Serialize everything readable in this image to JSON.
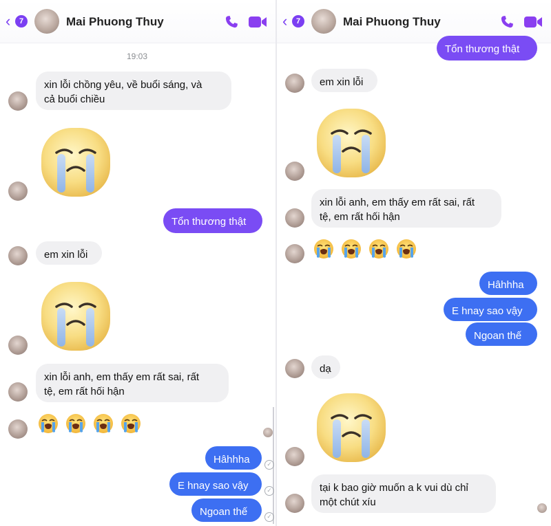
{
  "colors": {
    "accent": "#7b3ff2",
    "outgoing_purple": "#7a4cf4",
    "outgoing_blue": "#3d6ff2",
    "incoming": "#f0f0f2"
  },
  "header": {
    "back_count": "7",
    "contact_name": "Mai Phuong Thuy",
    "icons": [
      "back-chevron-icon",
      "phone-icon",
      "video-call-icon"
    ]
  },
  "left": {
    "timestamp": "19:03",
    "msg1": "xin lỗi chồng yêu, về buổi sáng, và",
    "msg1b": "cả buổi chiều",
    "msg2": "Tổn thương thật",
    "msg3": "em xin lỗi",
    "msg4": "xin lỗi anh, em thấy em rất sai, rất",
    "msg4b": "tệ, em rất hối hận",
    "msg5": "Hâhhha",
    "msg6": "E hnay sao vậy",
    "msg7": "Ngoan thế"
  },
  "right": {
    "msg1": "Tổn thương thật",
    "msg2": "em xin lỗi",
    "msg3": "xin lỗi anh, em thấy em rất sai, rất",
    "msg3b": "tệ, em rất hối hận",
    "msg4": "Hâhhha",
    "msg5": "E hnay sao vậy",
    "msg6": "Ngoan thế",
    "msg7": "dạ",
    "msg8": "tại k bao giờ muốn a k vui dù chỉ",
    "msg8b": "một chút xíu"
  }
}
